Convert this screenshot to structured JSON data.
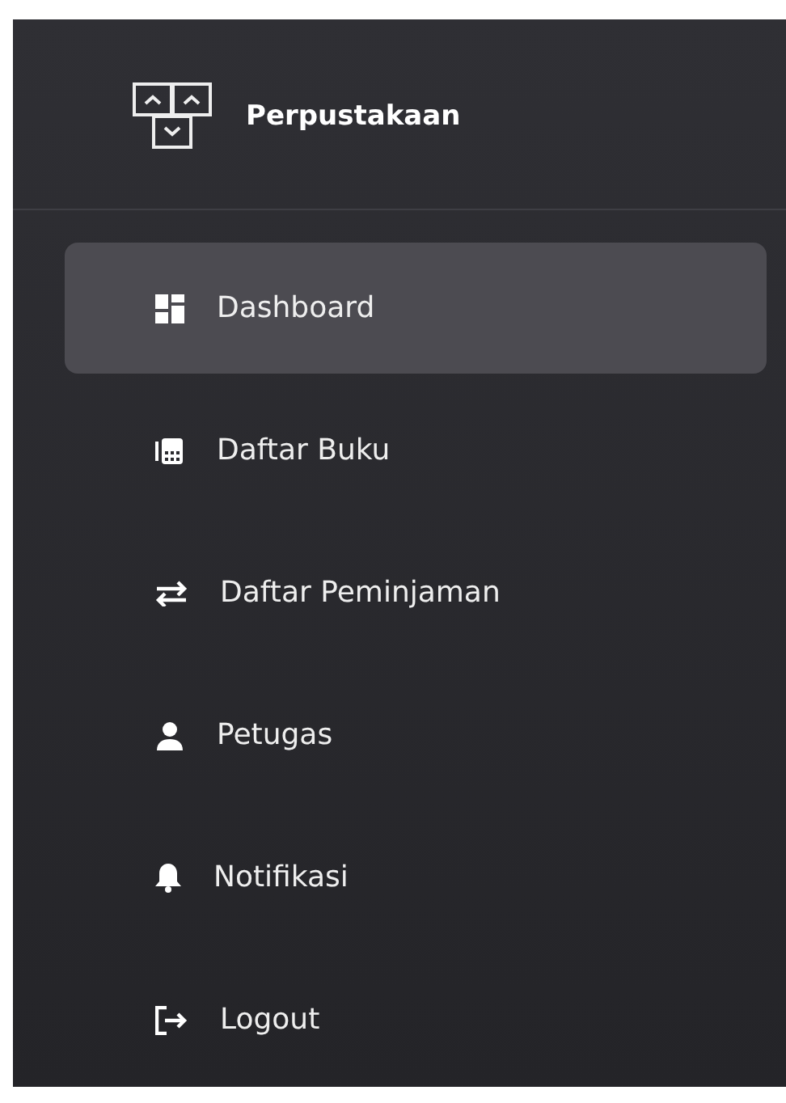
{
  "sidebar": {
    "brand": {
      "title": "Perpustakaan"
    },
    "items": [
      {
        "label": "Dashboard",
        "kind": "dashboard",
        "selected": true
      },
      {
        "label": "Daftar Buku",
        "kind": "books",
        "selected": false
      },
      {
        "label": "Daftar Peminjaman",
        "kind": "swap",
        "selected": false
      },
      {
        "label": "Petugas",
        "kind": "person",
        "selected": false
      },
      {
        "label": "Notifikasi",
        "kind": "bell",
        "selected": false
      },
      {
        "label": "Logout",
        "kind": "logout",
        "selected": false
      }
    ]
  }
}
